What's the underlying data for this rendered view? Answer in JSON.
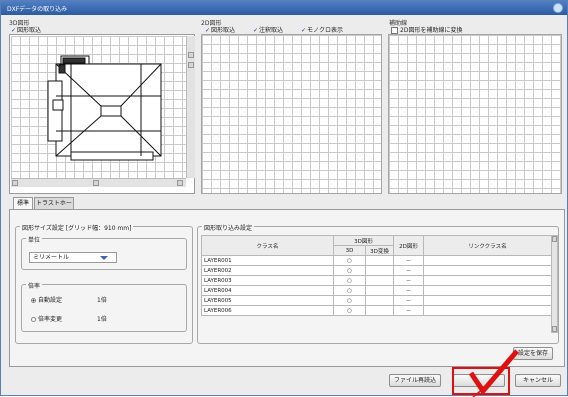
{
  "window": {
    "title": "DXFデータの取り込み"
  },
  "panels": {
    "p3d": {
      "label": "3D図形",
      "checkbox": "図形取込"
    },
    "p2d": {
      "label": "2D図形",
      "checkboxes": [
        "図形取込",
        "注釈取込",
        "モノクロ表示"
      ]
    },
    "aux": {
      "label": "補助線",
      "checkbox": "2D図形を補助線に変換"
    }
  },
  "tabs": [
    "標準",
    "トラストホーム"
  ],
  "size_settings": {
    "label": "図形サイズ設定 [グリッド幅：910 mm]",
    "unit": {
      "label": "単位",
      "selected": "ミリメートル"
    },
    "scale": {
      "label": "倍率",
      "options": [
        {
          "label": "自動設定",
          "value": "1倍",
          "selected": true
        },
        {
          "label": "倍率変更",
          "value": "1倍",
          "selected": false
        }
      ]
    }
  },
  "import_settings": {
    "label": "図形取り込み設定",
    "headers": {
      "class_name": "クラス名",
      "fig3d": "3D図形",
      "sub_3d": "3D",
      "sub_3dconv": "3D変換",
      "fig2d": "2D図形",
      "link": "リンククラス名"
    },
    "rows": [
      {
        "name": "LAYER001",
        "c3d": "○",
        "conv": "",
        "c2d": "－",
        "link": ""
      },
      {
        "name": "LAYER002",
        "c3d": "○",
        "conv": "",
        "c2d": "－",
        "link": ""
      },
      {
        "name": "LAYER003",
        "c3d": "○",
        "conv": "",
        "c2d": "－",
        "link": ""
      },
      {
        "name": "LAYER004",
        "c3d": "○",
        "conv": "",
        "c2d": "－",
        "link": ""
      },
      {
        "name": "LAYER005",
        "c3d": "○",
        "conv": "",
        "c2d": "－",
        "link": ""
      },
      {
        "name": "LAYER006",
        "c3d": "○",
        "conv": "",
        "c2d": "－",
        "link": ""
      }
    ],
    "save_label": "設定を保存"
  },
  "footer": {
    "reload": "ファイル再読込",
    "ok": "",
    "cancel": "キャンセル"
  },
  "colors": {
    "highlight": "#e01010",
    "check": "#e01010"
  }
}
